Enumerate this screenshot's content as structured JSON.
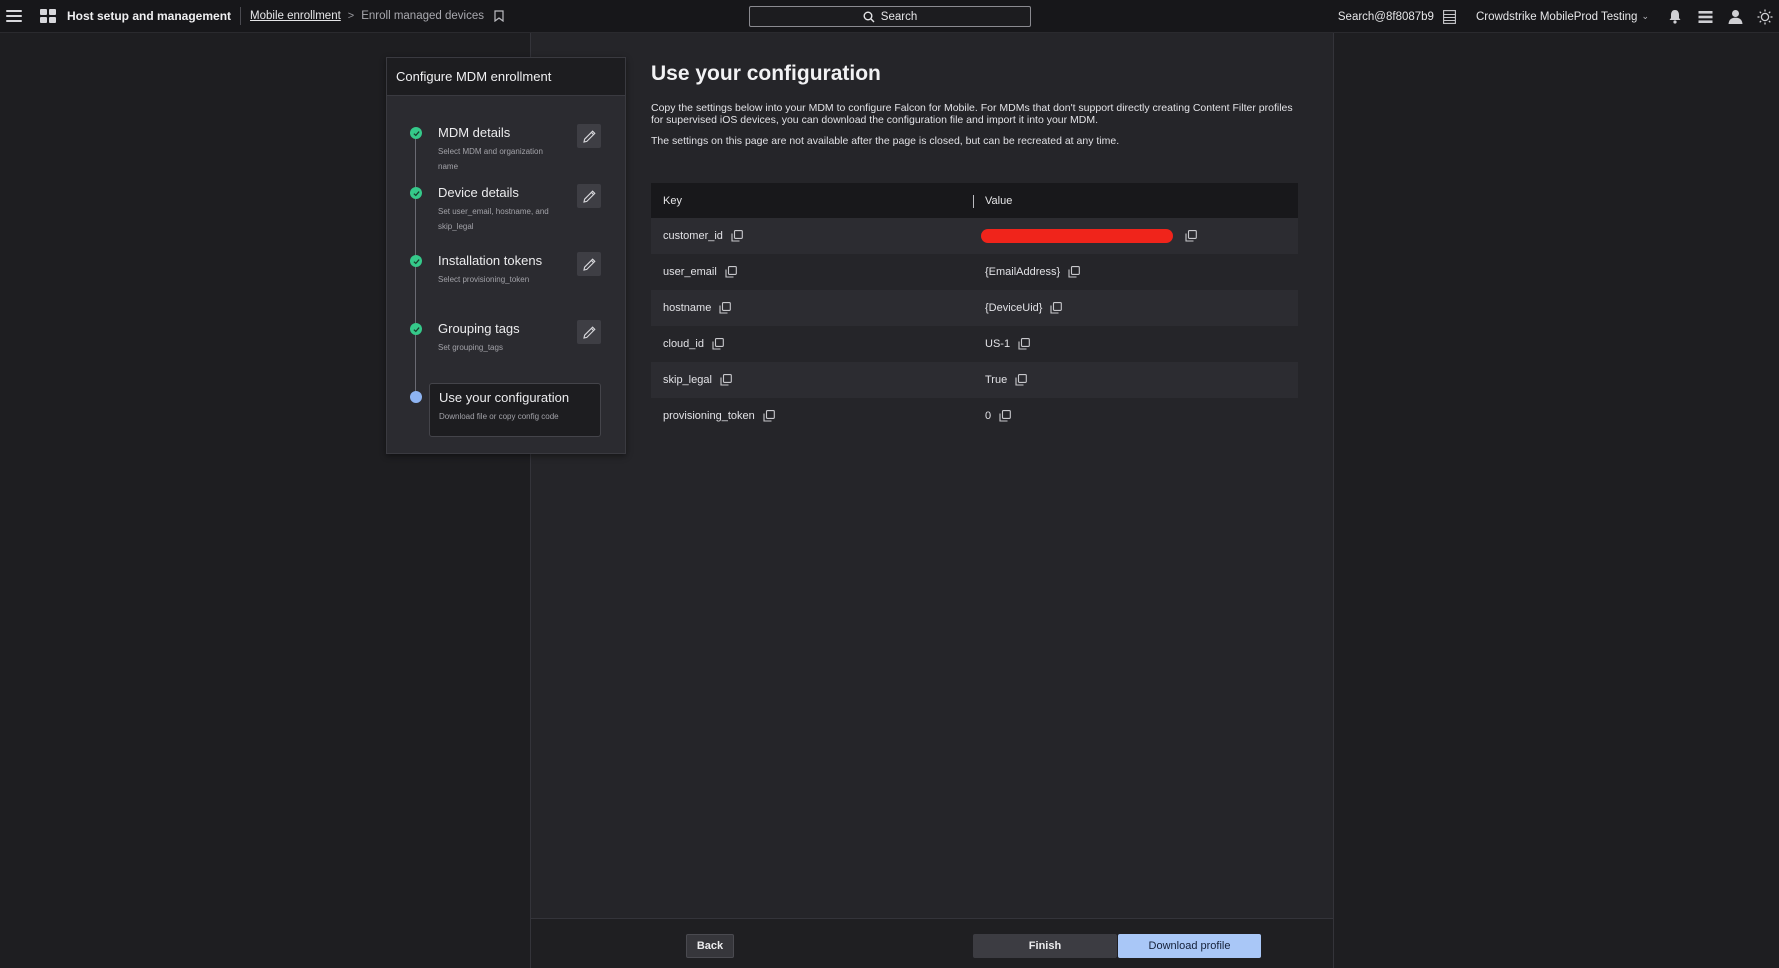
{
  "topbar": {
    "app_title": "Host setup and management",
    "breadcrumb": {
      "link": "Mobile enrollment",
      "separator": ">",
      "current": "Enroll managed devices"
    },
    "search_label": "Search",
    "user_search": "Search@8f8087b9",
    "tenant": "Crowdstrike MobileProd Testing"
  },
  "steps_panel": {
    "title": "Configure MDM enrollment",
    "steps": [
      {
        "title": "MDM details",
        "subtitle": "Select MDM and organization name",
        "status": "complete"
      },
      {
        "title": "Device details",
        "subtitle": "Set user_email, hostname, and skip_legal",
        "status": "complete"
      },
      {
        "title": "Installation tokens",
        "subtitle": "Select provisioning_token",
        "status": "complete"
      },
      {
        "title": "Grouping tags",
        "subtitle": "Set grouping_tags",
        "status": "complete"
      },
      {
        "title": "Use your configuration",
        "subtitle": "Download file or copy config code",
        "status": "current"
      }
    ]
  },
  "main": {
    "title": "Use your configuration",
    "description": "Copy the settings below into your MDM to configure Falcon for Mobile. For MDMs that don't support directly creating Content Filter profiles for supervised iOS devices, you can download the configuration file and import it into your MDM.",
    "note": "The settings on this page are not available after the page is closed, but can be recreated at any time.",
    "table": {
      "headers": {
        "key": "Key",
        "value": "Value"
      },
      "rows": [
        {
          "key": "customer_id",
          "value": "",
          "redacted": true
        },
        {
          "key": "user_email",
          "value": "{EmailAddress}"
        },
        {
          "key": "hostname",
          "value": "{DeviceUid}"
        },
        {
          "key": "cloud_id",
          "value": "US-1"
        },
        {
          "key": "skip_legal",
          "value": "True"
        },
        {
          "key": "provisioning_token",
          "value": "0"
        }
      ]
    }
  },
  "footer": {
    "back_label": "Back",
    "finish_label": "Finish",
    "download_label": "Download profile"
  },
  "colors": {
    "accent": "#a9c7f7",
    "complete": "#35c98a",
    "current": "#8eb4f2",
    "redaction": "#f0241b"
  }
}
